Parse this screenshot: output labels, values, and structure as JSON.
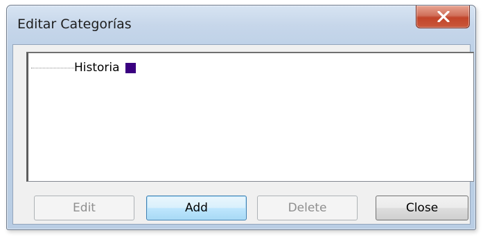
{
  "window": {
    "title": "Editar Categorías"
  },
  "titlebar": {
    "close_icon": "close-x-icon",
    "close_color": "#c2442a"
  },
  "tree": {
    "items": [
      {
        "label": "Historia",
        "color": "#3a0080"
      }
    ]
  },
  "buttons": {
    "edit": "Edit",
    "add": "Add",
    "delete": "Delete",
    "close": "Close"
  }
}
